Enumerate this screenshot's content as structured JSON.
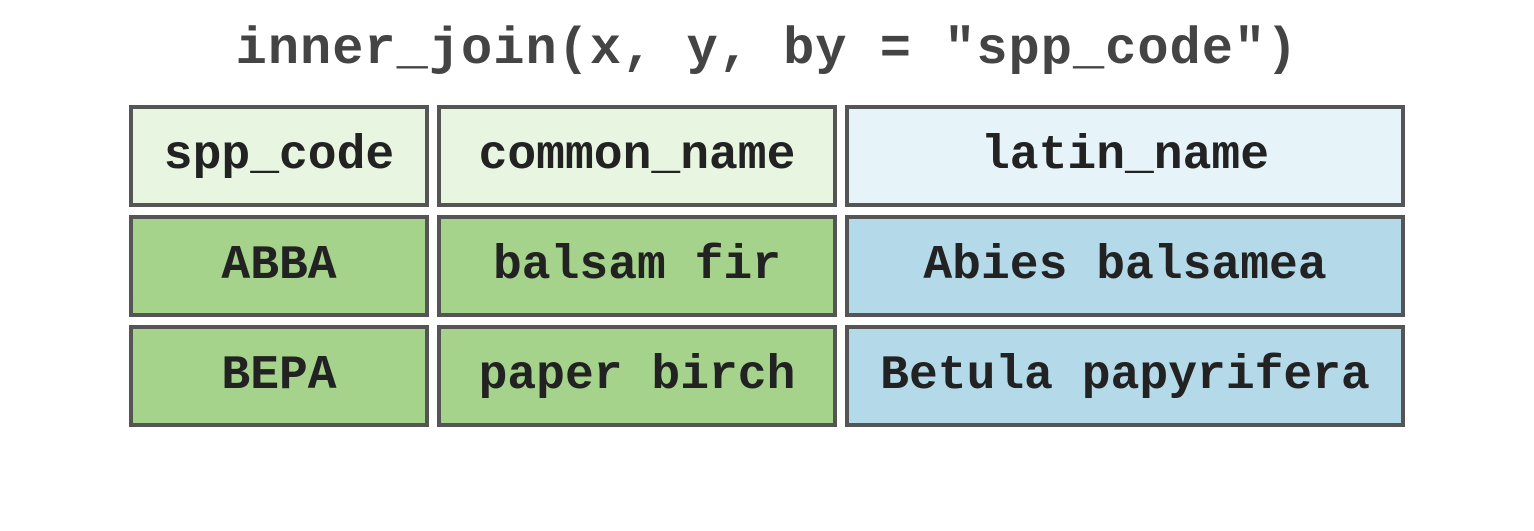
{
  "title": "inner_join(x, y, by = \"spp_code\")",
  "headers": {
    "col1": "spp_code",
    "col2": "common_name",
    "col3": "latin_name"
  },
  "rows": [
    {
      "col1": "ABBA",
      "col2": "balsam fir",
      "col3": "Abies balsamea"
    },
    {
      "col1": "BEPA",
      "col2": "paper birch",
      "col3": "Betula papyrifera"
    }
  ],
  "colors": {
    "header_green": "#e8f5e1",
    "header_blue": "#e6f4f9",
    "data_green": "#a5d38b",
    "data_blue": "#b4d9e8",
    "border": "#555555"
  }
}
